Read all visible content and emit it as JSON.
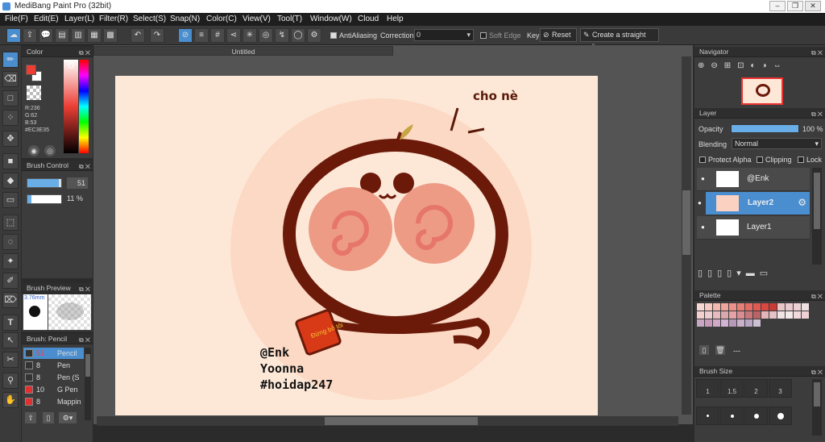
{
  "app": {
    "title": "MediBang Paint Pro (32bit)"
  },
  "menu": [
    "File(F)",
    "Edit(E)",
    "Layer(L)",
    "Filter(R)",
    "Select(S)",
    "Snap(N)",
    "Color(C)",
    "View(V)",
    "Tool(T)",
    "Window(W)",
    "Cloud",
    "Help"
  ],
  "toolbar": {
    "antialiasing": "AntiAliasing",
    "correction_label": "Correction",
    "correction_value": "0",
    "soft_edge": "Soft Edge",
    "key_label": "Key",
    "reset": "Reset",
    "straight_line": "Create a straight line"
  },
  "color_panel": {
    "title": "Color",
    "r": "R:236",
    "g": "G:62",
    "b": "B:53",
    "hex": "#EC3E35",
    "fg_color": "#ec3e35",
    "bg_color": "#ffffff"
  },
  "brush_control": {
    "title": "Brush Control",
    "size": "51",
    "opacity": "11 %",
    "size_fraction": 0.92,
    "opacity_fraction": 0.11
  },
  "brush_preview": {
    "title": "Brush Preview",
    "size_label": "3.76mm"
  },
  "brush_list": {
    "title": "Brush: Pencil",
    "items": [
      {
        "size": "51",
        "name": "Pencil",
        "color": "#333333"
      },
      {
        "size": "8",
        "name": "Pen",
        "color": "#333333"
      },
      {
        "size": "8",
        "name": "Pen (S",
        "color": "#333333"
      },
      {
        "size": "10",
        "name": "G Pen",
        "color": "#e03030"
      },
      {
        "size": "8",
        "name": "Mappin",
        "color": "#e03030"
      }
    ]
  },
  "document": {
    "tab": "Untitled"
  },
  "artwork": {
    "handwriting_top": "cho\nnè",
    "signature": [
      "@Enk",
      "Yoonna",
      "#hoidap247"
    ],
    "tag_text": "Đừng bỏ tôi"
  },
  "navigator": {
    "title": "Navigator"
  },
  "layer_panel": {
    "title": "Layer",
    "opacity_label": "Opacity",
    "opacity_value": "100 %",
    "blending_label": "Blending",
    "blending_value": "Normal",
    "protect_alpha": "Protect Alpha",
    "clipping": "Clipping",
    "lock": "Lock",
    "layers": [
      {
        "name": "@Enk",
        "selected": false
      },
      {
        "name": "Layer2",
        "selected": true
      },
      {
        "name": "Layer1",
        "selected": false
      }
    ]
  },
  "palette": {
    "title": "Palette",
    "value": "---",
    "colors": [
      "#f7d7d1",
      "#f6c9c2",
      "#f3b8b0",
      "#f0a59c",
      "#ec928a",
      "#e87f77",
      "#e56c64",
      "#e15a52",
      "#d94741",
      "#c73a36",
      "#e8c6c8",
      "#eac9cf",
      "#ebd0d4",
      "#efe1e3",
      "#f3cfcd",
      "#eecdd0",
      "#e6bcc0",
      "#dba8ae",
      "#e6a3a7",
      "#d98d92",
      "#ca777c",
      "#b96469",
      "#e2b6b9",
      "#e5c3c7",
      "#f1e4e5",
      "#f4eaea",
      "#f2d9dc",
      "#efd0d4",
      "#c7a7c1",
      "#c69ab8",
      "#cfa9c8",
      "#d3b3d3",
      "#b79ab8",
      "#c8b1c9",
      "#b8a6c2",
      "#ccc0d3"
    ]
  },
  "brush_size": {
    "title": "Brush Size",
    "sizes": [
      "1",
      "1.5",
      "2",
      "3"
    ]
  }
}
